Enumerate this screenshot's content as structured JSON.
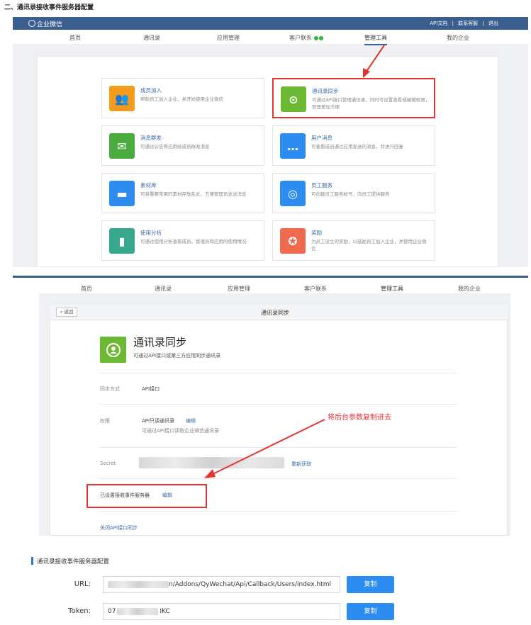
{
  "doc_heading": "二、通讯录接收事件服务器配置",
  "topbar": {
    "logo": "企业微信",
    "links": [
      "API文档",
      "|",
      "联系客服",
      "|",
      "退出"
    ]
  },
  "nav": [
    "首页",
    "通讯录",
    "应用管理",
    "客户联系",
    "管理工具",
    "我的企业"
  ],
  "cards": [
    {
      "title": "成员加入",
      "desc": "帮助员工加入企业，并开始使用企业微信",
      "color": "#f39b1a",
      "icon": "users-icon",
      "glyph": "👥"
    },
    {
      "title": "通讯录同步",
      "desc": "可通过API接口管理通讯录，同时可设置查看或编辑权限，管理更加方便",
      "color": "#6bb832",
      "icon": "sync-user-icon",
      "glyph": "⊙",
      "selected": true
    },
    {
      "title": "消息群发",
      "desc": "可通过公告等应用给成员群发消息",
      "color": "#4bab3f",
      "icon": "broadcast-icon",
      "glyph": "✉"
    },
    {
      "title": "用户消息",
      "desc": "可查看成员通过应用发送的消息，并进行回复",
      "color": "#2d8cf0",
      "icon": "chat-icon",
      "glyph": "…"
    },
    {
      "title": "素材库",
      "desc": "可将重要常用的素材存放在此，方便管理员发送消息",
      "color": "#2d8cf0",
      "icon": "folder-icon",
      "glyph": "▬"
    },
    {
      "title": "员工服务",
      "desc": "可创建员工服务帐号，向员工提供服务",
      "color": "#2d8cf0",
      "icon": "headset-icon",
      "glyph": "◎"
    },
    {
      "title": "使用分析",
      "desc": "可通过使用分析查看成员、管理员和应用的使用情况",
      "color": "#37a88d",
      "icon": "analytics-icon",
      "glyph": "▮"
    },
    {
      "title": "奖励",
      "desc": "为员工设立的奖励，以鼓励员工加入企业，并使用企业微信",
      "color": "#f06a4f",
      "icon": "award-icon",
      "glyph": "✪"
    }
  ],
  "sync_page": {
    "back": "« 返回",
    "title": "通讯录同步",
    "app_title": "通讯录同步",
    "app_desc": "可通过API接口或第三方应用同步通讯录",
    "sync_mode_label": "同步方式",
    "sync_mode_value": "API接口",
    "perm_label": "权限",
    "perm_value": "API只读通讯录",
    "perm_edit": "编辑",
    "perm_desc": "可通过API接口读取企业微信通讯录",
    "secret_label": "Secret",
    "secret_refresh": "重新获取",
    "event_server": "已设置接收事件服务器",
    "event_edit": "编辑",
    "close_api": "关闭API接口同步",
    "annotation": "将后台参数复制进去"
  },
  "config": {
    "section_title": "通讯录接收事件服务器配置",
    "url_label": "URL:",
    "url_value": "n/Addons/QyWechat/Api/Callback/Users/index.html",
    "token_label": "Token:",
    "token_prefix": "07",
    "token_suffix": "IKC",
    "copy": "复制"
  }
}
